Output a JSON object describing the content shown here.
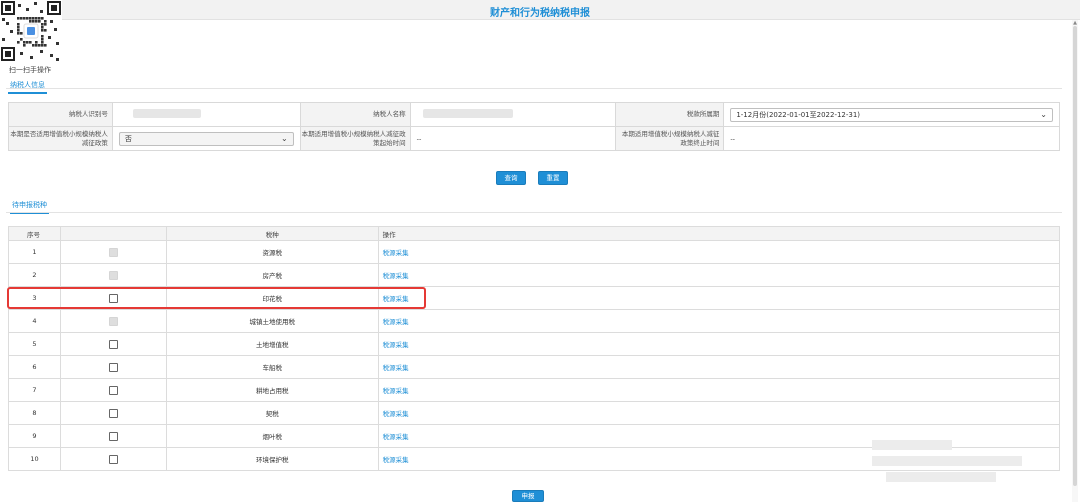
{
  "page": {
    "title": "财产和行为税纳税申报"
  },
  "qr": {
    "caption": "扫一扫手操作"
  },
  "tabs": {
    "taxpayer_info": "纳税人信息",
    "pending_taxes": "待申报税种"
  },
  "info_form": {
    "taxpayer_id_label": "纳税人识别号",
    "taxpayer_name_label": "纳税人名称",
    "tax_period_label": "税款所属期",
    "tax_period_value": "1-12月份(2022-01-01至2022-12-31)",
    "small_scale_label": "本期是否适用增值税小规模纳税人减征政策",
    "small_scale_value": "否",
    "policy_start_label": "本期适用增值税小规模纳税人减征政策起始时间",
    "policy_start_value": "--",
    "policy_end_label": "本期适用增值税小规模纳税人减征政策终止时间",
    "policy_end_value": "--"
  },
  "buttons": {
    "query": "查询",
    "reset": "重置",
    "submit": "申报"
  },
  "grid": {
    "columns": [
      "序号",
      "",
      "税种",
      "操作"
    ],
    "rows": [
      {
        "no": "1",
        "tax": "资源税",
        "op": "税源采集",
        "checkbox": "disabled"
      },
      {
        "no": "2",
        "tax": "房产税",
        "op": "税源采集",
        "checkbox": "disabled"
      },
      {
        "no": "3",
        "tax": "印花税",
        "op": "税源采集",
        "checkbox": "enabled"
      },
      {
        "no": "4",
        "tax": "城镇土地使用税",
        "op": "税源采集",
        "checkbox": "disabled"
      },
      {
        "no": "5",
        "tax": "土地增值税",
        "op": "税源采集",
        "checkbox": "enabled"
      },
      {
        "no": "6",
        "tax": "车船税",
        "op": "税源采集",
        "checkbox": "enabled"
      },
      {
        "no": "7",
        "tax": "耕地占用税",
        "op": "税源采集",
        "checkbox": "enabled"
      },
      {
        "no": "8",
        "tax": "契税",
        "op": "税源采集",
        "checkbox": "enabled"
      },
      {
        "no": "9",
        "tax": "烟叶税",
        "op": "税源采集",
        "checkbox": "enabled"
      },
      {
        "no": "10",
        "tax": "环境保护税",
        "op": "税源采集",
        "checkbox": "enabled"
      }
    ]
  },
  "colors": {
    "accent": "#1f8fd6",
    "highlight": "#e53935"
  },
  "icons": {
    "dropdown": "chevron-down-icon",
    "qr": "qr-code-icon"
  }
}
